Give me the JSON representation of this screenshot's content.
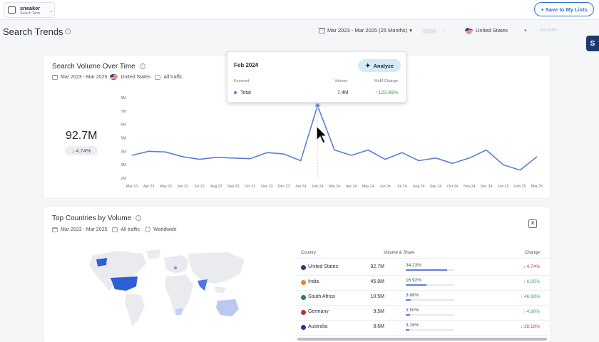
{
  "top_bar": {
    "term_name": "sneaker",
    "term_sub": "Search Term",
    "save_label": "+ Save to My Lists"
  },
  "header": {
    "title": "Search Trends",
    "date_range": "Mar 2023 - Mar 2025 (25 Months)",
    "country": "United States",
    "traffic": "All traffic",
    "side_tab_label": "S"
  },
  "volume_card": {
    "title": "Search Volume Over Time",
    "date_range": "Mar 2023 - Mar 2025",
    "country": "United States",
    "traffic": "All traffic",
    "total": "92.7M",
    "change": "↓ 4.74%"
  },
  "tooltip": {
    "month": "Feb 2024",
    "analyze_label": "Analyze",
    "col_keyword": "Keyword",
    "col_volume": "Volume",
    "col_mom": "MoM Change",
    "row_keyword": "Total",
    "row_volume": "7.4M",
    "row_mom": "↑123.99%"
  },
  "chart_data": {
    "type": "line",
    "title": "Search Volume Over Time",
    "x": [
      "Mar 23",
      "Apr 23",
      "May 23",
      "Jun 23",
      "Jul 23",
      "Aug 23",
      "Sep 23",
      "Oct 23",
      "Nov 23",
      "Dec 23",
      "Jan 24",
      "Feb 24",
      "Mar 24",
      "Apr 24",
      "May 24",
      "Jun 24",
      "Jul 24",
      "Aug 24",
      "Sep 24",
      "Oct 24",
      "Nov 24",
      "Dec 24",
      "Jan 25",
      "Feb 25",
      "Mar 25"
    ],
    "series": [
      {
        "values": [
          3.7,
          4.0,
          3.95,
          3.6,
          3.4,
          3.55,
          3.5,
          3.45,
          3.9,
          3.8,
          3.3,
          7.4,
          4.1,
          3.7,
          4.1,
          3.4,
          3.9,
          3.3,
          3.5,
          3.1,
          3.5,
          4.1,
          3.0,
          2.6,
          3.6
        ]
      }
    ],
    "y_ticks": [
      "2M",
      "3M",
      "4M",
      "5M",
      "6M",
      "7M",
      "8M"
    ],
    "ylim": [
      2,
      8
    ],
    "grid": false,
    "highlight_index": 11,
    "color": "#5b7fd4"
  },
  "countries_card": {
    "title": "Top Countries by Volume",
    "date_range": "Mar 2023 - Mar 2025",
    "traffic": "All traffic",
    "scope": "Worldwide",
    "excel_label": "X",
    "col_country": "Country",
    "col_volume": "Volume & Share",
    "col_change": "Change",
    "rows": [
      {
        "name": "United States",
        "volume": "92.7M",
        "share": "34.23%",
        "share_value": 34.23,
        "change": "↓ 4.74%",
        "dir": "down",
        "flag": "#2b3f85"
      },
      {
        "name": "India",
        "volume": "45.8M",
        "share": "16.92%",
        "share_value": 16.92,
        "change": "↑ 6.05%",
        "dir": "up",
        "flag": "#e8862e"
      },
      {
        "name": "South Africa",
        "volume": "10.5M",
        "share": "3.88%",
        "share_value": 3.88,
        "change": "↑ 46.68%",
        "dir": "up",
        "flag": "#1f8a4c"
      },
      {
        "name": "Germany",
        "volume": "9.5M",
        "share": "3.50%",
        "share_value": 3.5,
        "change": "↑ 4.88%",
        "dir": "up",
        "flag": "#c62d2d"
      },
      {
        "name": "Australia",
        "volume": "8.6M",
        "share": "3.16%",
        "share_value": 3.16,
        "change": "↓ 28.18%",
        "dir": "down",
        "flag": "#1b3a8a"
      }
    ]
  }
}
